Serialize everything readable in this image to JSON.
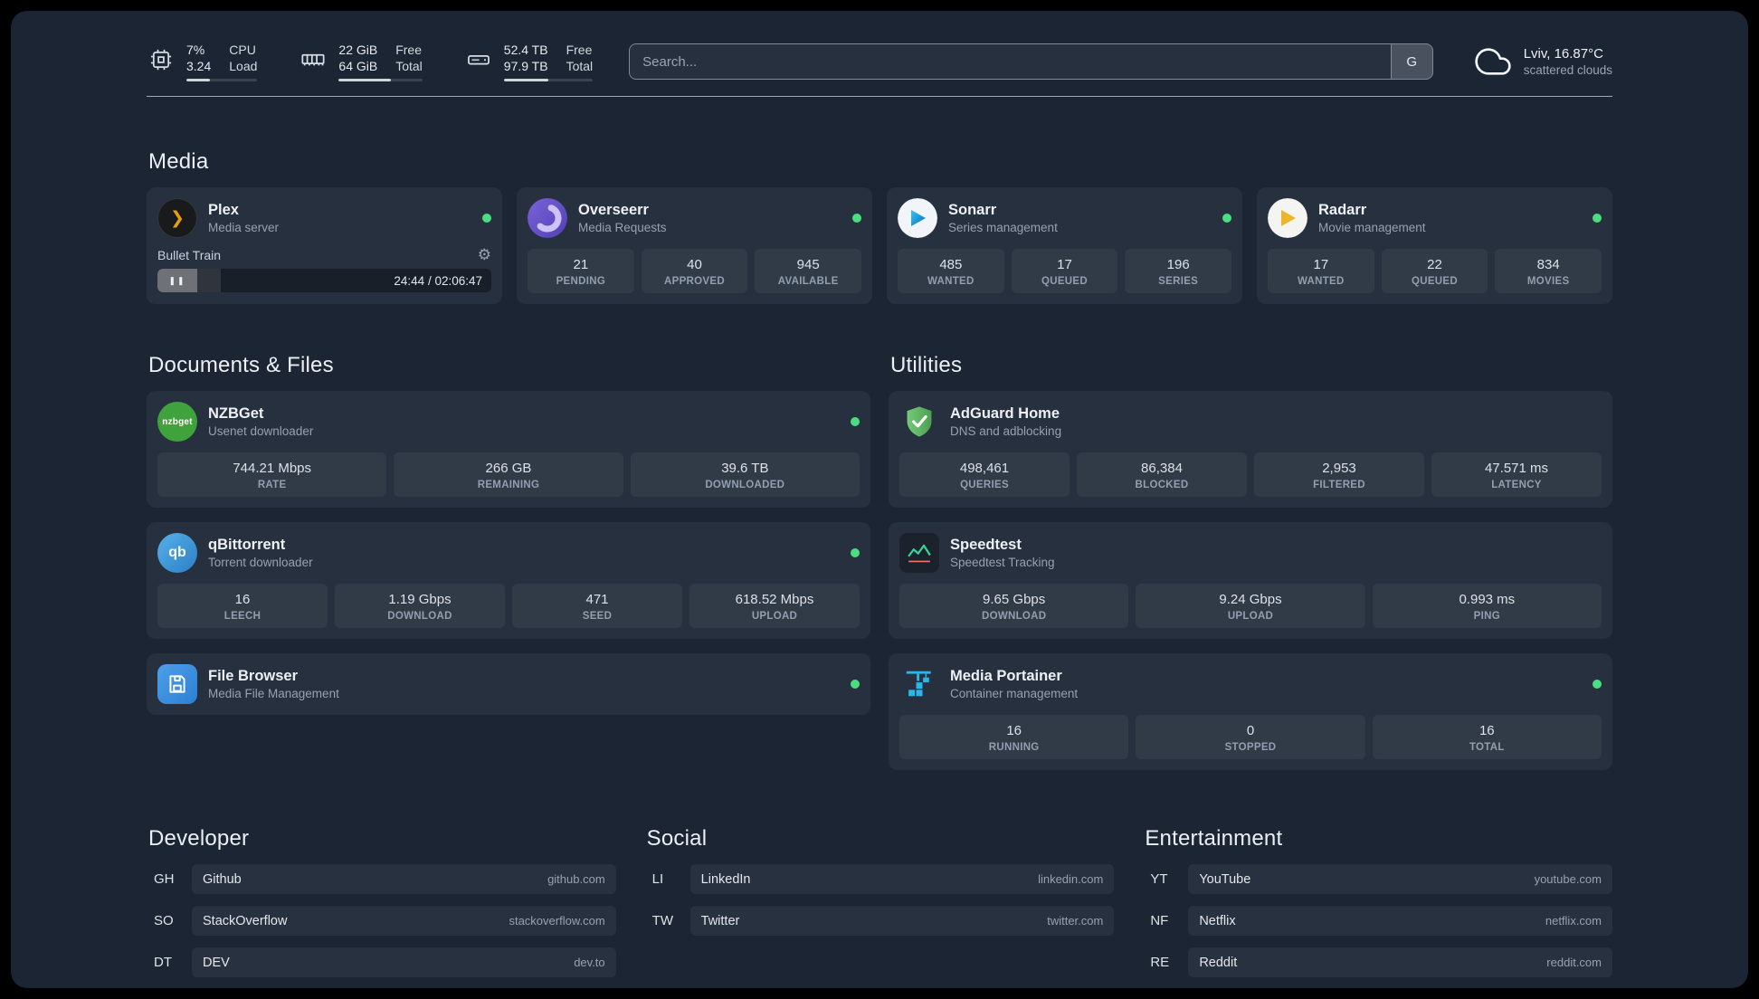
{
  "topbar": {
    "resources": [
      {
        "value1": "7%",
        "value2": "3.24",
        "label1": "CPU",
        "label2": "Load",
        "used_percent": 33
      },
      {
        "value1": "22 GiB",
        "value2": "64 GiB",
        "label1": "Free",
        "label2": "Total",
        "used_percent": 62
      },
      {
        "value1": "52.4 TB",
        "value2": "97.9 TB",
        "label1": "Free",
        "label2": "Total",
        "used_percent": 50
      }
    ],
    "search": {
      "placeholder": "Search...",
      "provider_label": "G"
    },
    "weather": {
      "location": "Lviv, 16.87°C",
      "condition": "scattered clouds"
    }
  },
  "media": {
    "title": "Media",
    "plex": {
      "name": "Plex",
      "desc": "Media server",
      "now_playing": "Bullet Train",
      "time_display": "24:44 / 02:06:47",
      "progress_percent": 19,
      "pause_glyph": "❚❚",
      "gear_glyph": "⚙"
    },
    "overseerr": {
      "name": "Overseerr",
      "desc": "Media Requests",
      "stats": [
        {
          "value": "21",
          "label": "PENDING"
        },
        {
          "value": "40",
          "label": "APPROVED"
        },
        {
          "value": "945",
          "label": "AVAILABLE"
        }
      ]
    },
    "sonarr": {
      "name": "Sonarr",
      "desc": "Series management",
      "stats": [
        {
          "value": "485",
          "label": "WANTED"
        },
        {
          "value": "17",
          "label": "QUEUED"
        },
        {
          "value": "196",
          "label": "SERIES"
        }
      ]
    },
    "radarr": {
      "name": "Radarr",
      "desc": "Movie management",
      "stats": [
        {
          "value": "17",
          "label": "WANTED"
        },
        {
          "value": "22",
          "label": "QUEUED"
        },
        {
          "value": "834",
          "label": "MOVIES"
        }
      ]
    }
  },
  "documents": {
    "title": "Documents & Files",
    "nzbget": {
      "name": "NZBGet",
      "desc": "Usenet downloader",
      "icon_text": "nzbget",
      "stats": [
        {
          "value": "744.21 Mbps",
          "label": "RATE"
        },
        {
          "value": "266 GB",
          "label": "REMAINING"
        },
        {
          "value": "39.6 TB",
          "label": "DOWNLOADED"
        }
      ]
    },
    "qbittorrent": {
      "name": "qBittorrent",
      "desc": "Torrent downloader",
      "icon_text": "qb",
      "stats": [
        {
          "value": "16",
          "label": "LEECH"
        },
        {
          "value": "1.19 Gbps",
          "label": "DOWNLOAD"
        },
        {
          "value": "471",
          "label": "SEED"
        },
        {
          "value": "618.52 Mbps",
          "label": "UPLOAD"
        }
      ]
    },
    "filebrowser": {
      "name": "File Browser",
      "desc": "Media File Management"
    }
  },
  "utilities": {
    "title": "Utilities",
    "adguard": {
      "name": "AdGuard Home",
      "desc": "DNS and adblocking",
      "stats": [
        {
          "value": "498,461",
          "label": "QUERIES"
        },
        {
          "value": "86,384",
          "label": "BLOCKED"
        },
        {
          "value": "2,953",
          "label": "FILTERED"
        },
        {
          "value": "47.571 ms",
          "label": "LATENCY"
        }
      ]
    },
    "speedtest": {
      "name": "Speedtest",
      "desc": "Speedtest Tracking",
      "stats": [
        {
          "value": "9.65 Gbps",
          "label": "DOWNLOAD"
        },
        {
          "value": "9.24 Gbps",
          "label": "UPLOAD"
        },
        {
          "value": "0.993 ms",
          "label": "PING"
        }
      ]
    },
    "portainer": {
      "name": "Media Portainer",
      "desc": "Container management",
      "stats": [
        {
          "value": "16",
          "label": "RUNNING"
        },
        {
          "value": "0",
          "label": "STOPPED"
        },
        {
          "value": "16",
          "label": "TOTAL"
        }
      ]
    }
  },
  "bookmarks": {
    "developer": {
      "title": "Developer",
      "items": [
        {
          "abbr": "GH",
          "name": "Github",
          "url": "github.com"
        },
        {
          "abbr": "SO",
          "name": "StackOverflow",
          "url": "stackoverflow.com"
        },
        {
          "abbr": "DT",
          "name": "DEV",
          "url": "dev.to"
        }
      ]
    },
    "social": {
      "title": "Social",
      "items": [
        {
          "abbr": "LI",
          "name": "LinkedIn",
          "url": "linkedin.com"
        },
        {
          "abbr": "TW",
          "name": "Twitter",
          "url": "twitter.com"
        }
      ]
    },
    "entertainment": {
      "title": "Entertainment",
      "items": [
        {
          "abbr": "YT",
          "name": "YouTube",
          "url": "youtube.com"
        },
        {
          "abbr": "NF",
          "name": "Netflix",
          "url": "netflix.com"
        },
        {
          "abbr": "RE",
          "name": "Reddit",
          "url": "reddit.com"
        }
      ]
    }
  },
  "colors": {
    "status_online": "#4ade80",
    "plex_accent": "#e5a00d",
    "adguard_green": "#66c36a",
    "portainer_blue": "#29b6e8"
  }
}
